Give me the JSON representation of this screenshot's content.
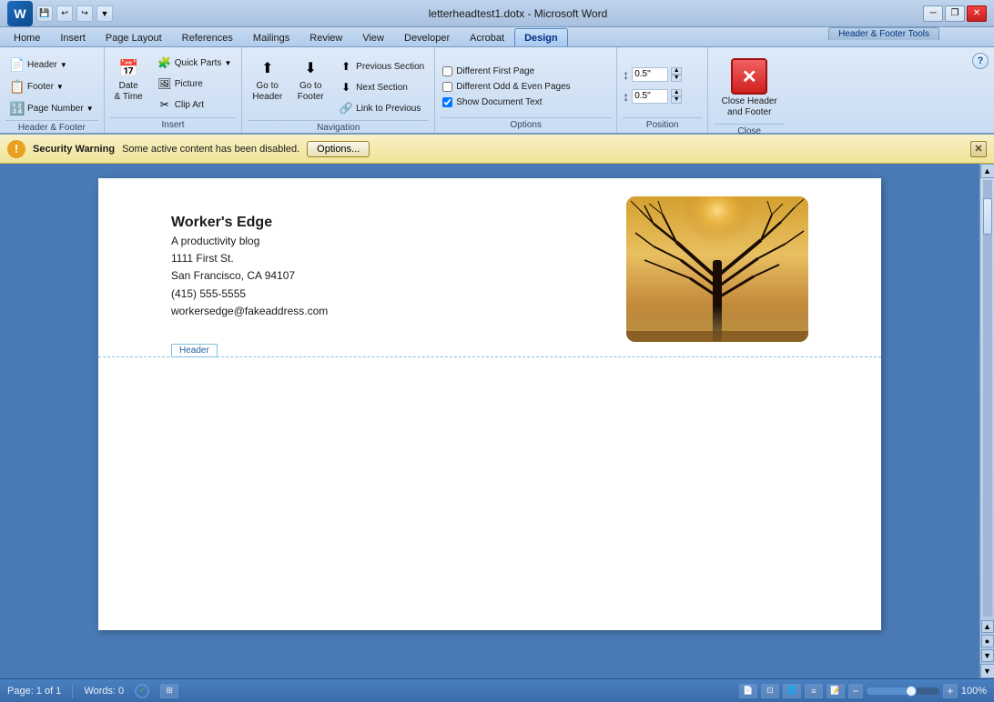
{
  "titlebar": {
    "title": "letterheadtest1.dotx - Microsoft Word",
    "tools_label": "Header & Footer Tools",
    "close_label": "✕",
    "minimize_label": "─",
    "restore_label": "❐"
  },
  "ribbon_tabs": [
    {
      "id": "home",
      "label": "Home",
      "letter": "H",
      "active": false
    },
    {
      "id": "insert",
      "label": "Insert",
      "letter": "N",
      "active": false
    },
    {
      "id": "page-layout",
      "label": "Page Layout",
      "letter": "P",
      "active": false
    },
    {
      "id": "references",
      "label": "References",
      "letter": "S",
      "active": false
    },
    {
      "id": "mailings",
      "label": "Mailings",
      "letter": "M",
      "active": false
    },
    {
      "id": "review",
      "label": "Review",
      "letter": "R",
      "active": false
    },
    {
      "id": "view",
      "label": "View",
      "letter": "W",
      "active": false
    },
    {
      "id": "developer",
      "label": "Developer",
      "letter": "L",
      "active": false
    },
    {
      "id": "acrobat",
      "label": "Acrobat",
      "letter": "B",
      "active": false
    },
    {
      "id": "design",
      "label": "Design",
      "letter": "JH",
      "active": true
    }
  ],
  "ribbon_groups": {
    "header_footer": {
      "label": "Header & Footer",
      "header_btn": "Header",
      "footer_btn": "Footer",
      "page_number_btn": "Page Number"
    },
    "insert": {
      "label": "Insert",
      "date_time_btn": "Date\n& Time",
      "quick_parts_btn": "Quick Parts",
      "picture_btn": "Picture",
      "clip_art_btn": "Clip Art"
    },
    "navigation": {
      "label": "Navigation",
      "go_to_header_btn": "Go to\nHeader",
      "go_to_footer_btn": "Go to\nFooter",
      "previous_section_btn": "Previous Section",
      "next_section_btn": "Next Section",
      "link_to_previous_btn": "Link to Previous"
    },
    "options": {
      "label": "Options",
      "different_first_page": "Different First Page",
      "different_odd_even": "Different Odd & Even Pages",
      "show_document_text": "Show Document Text",
      "show_document_text_checked": true
    },
    "position": {
      "label": "Position",
      "header_from_top_value": "0.5\"",
      "footer_from_bottom_value": "0.5\""
    },
    "close": {
      "label": "Close",
      "close_hf_btn": "Close Header\nand Footer"
    }
  },
  "security_bar": {
    "title": "Security Warning",
    "message": "Some active content has been disabled.",
    "options_btn": "Options...",
    "warning_icon": "!"
  },
  "document": {
    "company_name": "Worker's Edge",
    "tagline": "A productivity blog",
    "address1": "1111 First St.",
    "city_state": "San Francisco, CA 94107",
    "phone": "(415) 555-5555",
    "email": "workersedge@fakeaddress.com",
    "header_label": "Header"
  },
  "statusbar": {
    "page": "Page: 1 of 1",
    "words": "Words: 0",
    "zoom": "100%"
  }
}
